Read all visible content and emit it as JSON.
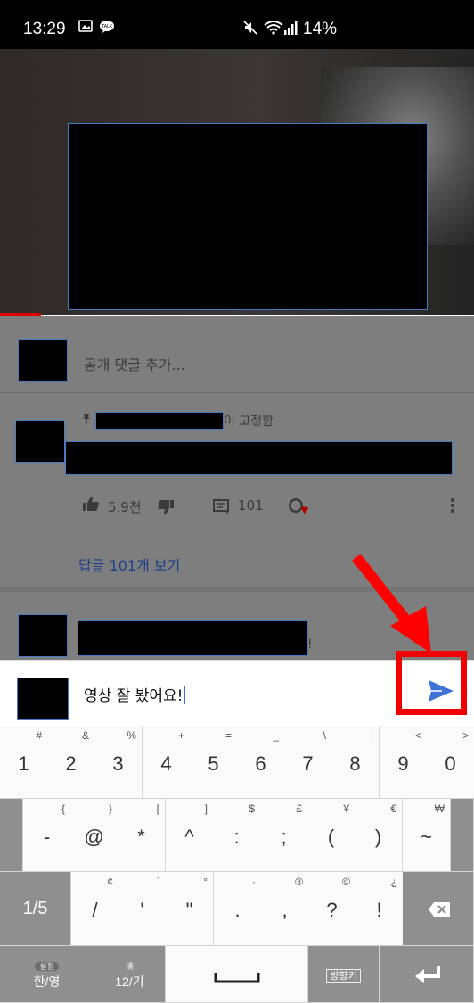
{
  "status": {
    "time": "13:29",
    "battery": "14%"
  },
  "comments": {
    "add_placeholder": "공개 댓글 추가...",
    "pinned_suffix": "이 고정함",
    "like_count": "5.9천",
    "reply_count": "101",
    "view_replies": "답글 101개 보기",
    "second_suffix": "!"
  },
  "input": {
    "text": "영상 잘 봤어요!"
  },
  "keyboard": {
    "row1": [
      {
        "main": "1",
        "sup": "#"
      },
      {
        "main": "2",
        "sup": "&"
      },
      {
        "main": "3",
        "sup": "%"
      },
      {
        "main": "4",
        "sup": "+"
      },
      {
        "main": "5",
        "sup": "="
      },
      {
        "main": "6",
        "sup": "_"
      },
      {
        "main": "7",
        "sup": "\\"
      },
      {
        "main": "8",
        "sup": "|"
      },
      {
        "main": "9",
        "sup": "<"
      },
      {
        "main": "0",
        "sup": ">"
      }
    ],
    "row2": [
      {
        "main": "-",
        "sup": "{"
      },
      {
        "main": "@",
        "sup": "}"
      },
      {
        "main": "*",
        "sup": "["
      },
      {
        "main": "^",
        "sup": "]"
      },
      {
        "main": ":",
        "sup": "$"
      },
      {
        "main": ";",
        "sup": "£"
      },
      {
        "main": "(",
        "sup": "¥"
      },
      {
        "main": ")",
        "sup": "€"
      },
      {
        "main": "~",
        "sup": "₩"
      }
    ],
    "row3_left": "1/5",
    "row3": [
      {
        "main": "/",
        "sup": "¢"
      },
      {
        "main": "'",
        "sup": "`"
      },
      {
        "main": "\"",
        "sup": "°"
      },
      {
        "main": ".",
        "sup": "·"
      },
      {
        "main": ",",
        "sup": "®"
      },
      {
        "main": "?",
        "sup": "©"
      },
      {
        "main": "!",
        "sup": "¿"
      }
    ],
    "lang_top": "설정",
    "lang_main": "한/영",
    "mode_top": "漢",
    "mode_main": "12/기",
    "arrow_key": "방향키"
  }
}
